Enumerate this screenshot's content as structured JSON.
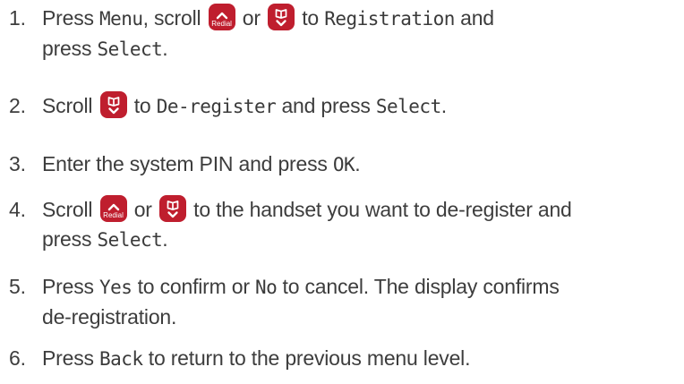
{
  "steps": [
    {
      "number": "1.",
      "parts": {
        "a": "Press ",
        "menu": "Menu",
        "b": ", scroll ",
        "c": " or ",
        "d": " to ",
        "registration": "Registration",
        "e": " and",
        "f": "press ",
        "select": "Select",
        "g": "."
      }
    },
    {
      "number": "2.",
      "parts": {
        "a": "Scroll ",
        "b": " to ",
        "deregister": "De-register",
        "c": " and press ",
        "select": "Select",
        "d": "."
      }
    },
    {
      "number": "3.",
      "parts": {
        "a": "Enter the system PIN and press ",
        "ok": "OK",
        "b": "."
      }
    },
    {
      "number": "4.",
      "parts": {
        "a": "Scroll ",
        "b": " or ",
        "c": " to the handset you want to de-register and",
        "d": "press ",
        "select": "Select",
        "e": "."
      }
    },
    {
      "number": "5.",
      "parts": {
        "a": "Press ",
        "yes": "Yes",
        "b": " to confirm or ",
        "no": "No",
        "c": " to cancel. The display confirms",
        "d": "de-registration."
      }
    },
    {
      "number": "6.",
      "parts": {
        "a": "Press ",
        "back": "Back",
        "b": " to return to the previous menu level."
      }
    }
  ],
  "keys": {
    "redial_label": "Redial",
    "up_icon": "chevron-up-icon",
    "down_icon": "phonebook-down-icon",
    "key_color": "#bf1e2e"
  }
}
